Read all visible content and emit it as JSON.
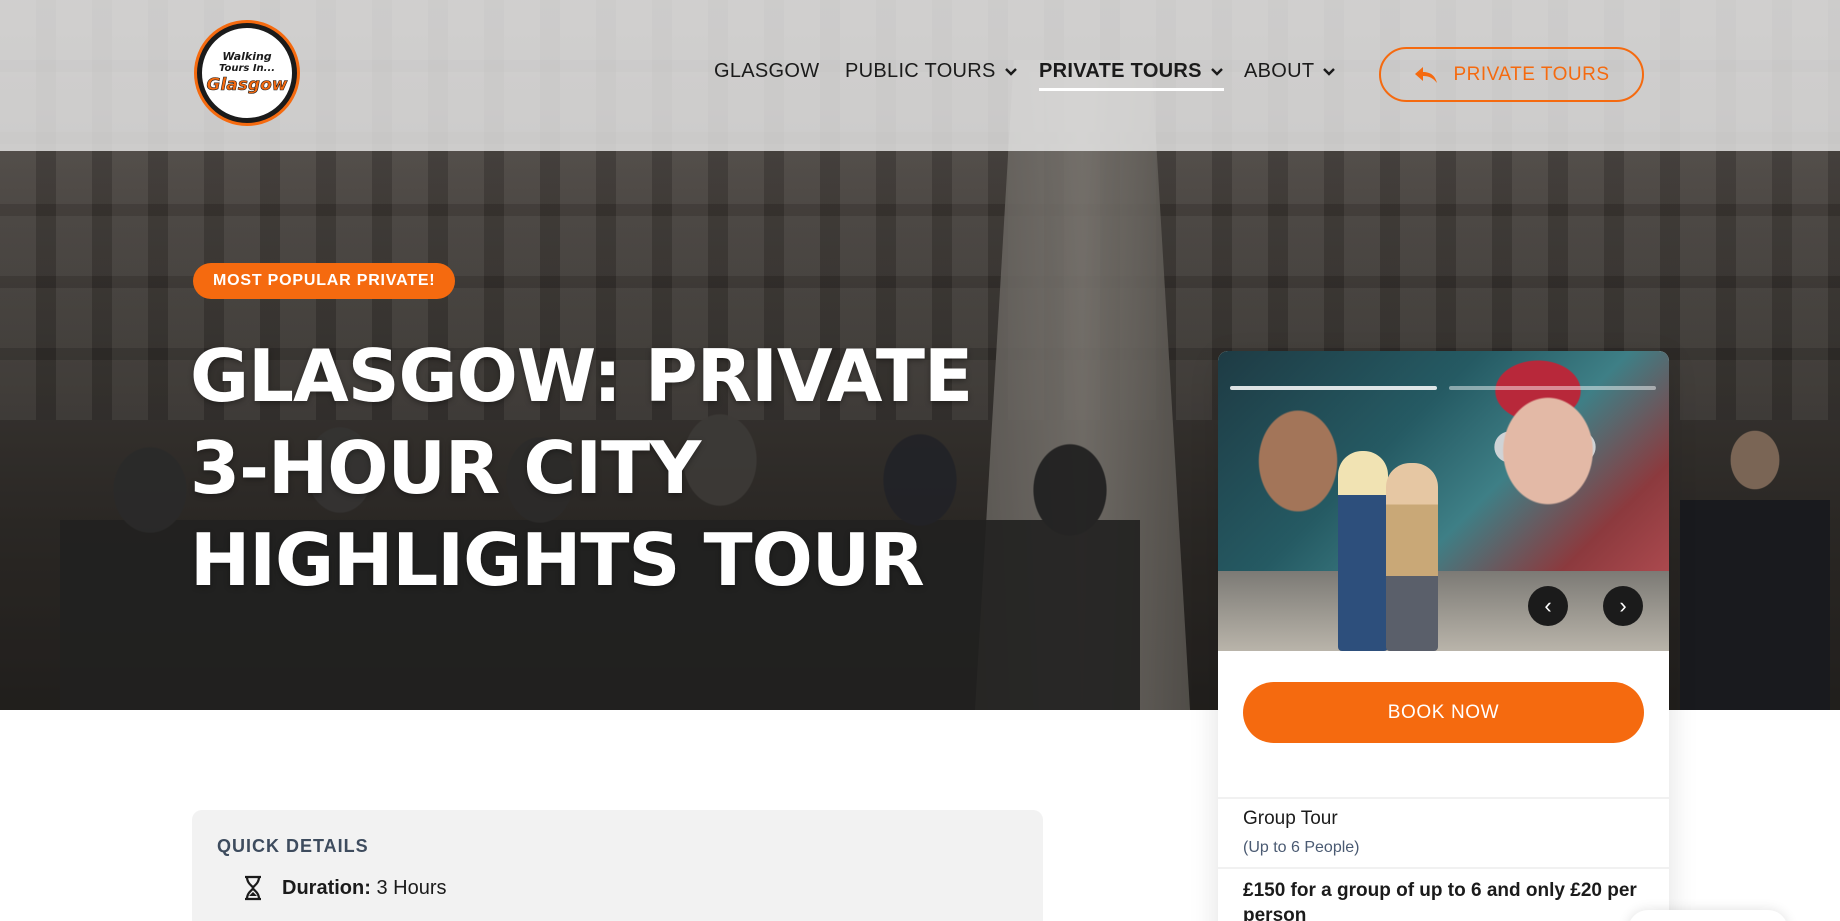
{
  "brand": {
    "logo_line1": "Walking",
    "logo_line2": "Tours In...",
    "logo_line3": "Glasgow"
  },
  "nav": {
    "items": [
      {
        "label": "GLASGOW",
        "has_dropdown": false,
        "active": false
      },
      {
        "label": "PUBLIC TOURS",
        "has_dropdown": true,
        "active": false
      },
      {
        "label": "PRIVATE TOURS",
        "has_dropdown": true,
        "active": true
      },
      {
        "label": "ABOUT",
        "has_dropdown": true,
        "active": false
      }
    ],
    "cta_label": "PRIVATE TOURS",
    "cta_icon": "back-arrow-icon"
  },
  "hero": {
    "badge": "MOST POPULAR PRIVATE!",
    "title": "GLASGOW: PRIVATE 3-HOUR CITY HIGHLIGHTS TOUR"
  },
  "booking": {
    "carousel": {
      "slide_count": 2,
      "active_slide": 1,
      "prev_icon": "chevron-left-icon",
      "next_icon": "chevron-right-icon",
      "prev_glyph": "‹",
      "next_glyph": "›"
    },
    "book_label": "BOOK NOW",
    "group_title": "Group Tour",
    "group_sub": "(Up to 6 People)",
    "price": "£150 for a group of up to 6 and only £20 per person"
  },
  "quick_details": {
    "title": "QUICK DETAILS",
    "rows": [
      {
        "icon": "hourglass-icon",
        "label": "Duration:",
        "value": "3 Hours"
      }
    ]
  },
  "colors": {
    "accent": "#f56a0f",
    "text_dark": "#1b1b1b",
    "muted_blue": "#4a5a72"
  }
}
